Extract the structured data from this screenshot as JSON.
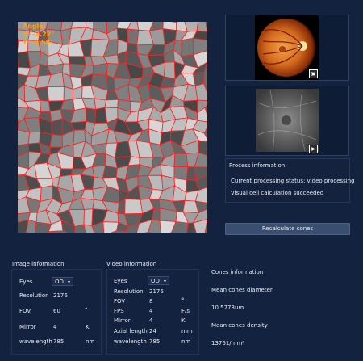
{
  "main_image": {
    "overlay": {
      "angle_label": "Angle:",
      "x_label": "X: -2.22°",
      "y_label": "Y: -0.58°"
    }
  },
  "thumbnails": {
    "fundus_icon": "expand-icon",
    "ir_icon": "play-icon"
  },
  "process_info": {
    "title": "Process information",
    "status": "Current processing status: video processing",
    "result": "Visual cell calculation succeeded"
  },
  "recalculate_button": "Recalculate cones",
  "image_info": {
    "title": "Image information",
    "eyes_label": "Eyes",
    "eyes_value": "OD",
    "resolution_label": "Resolution",
    "resolution_value": "2176",
    "fov_label": "FOV",
    "fov_value": "60",
    "fov_unit": "°",
    "mirror_label": "Mirror",
    "mirror_value": "4",
    "mirror_unit": "K",
    "wavelength_label": "wavelength",
    "wavelength_value": "785",
    "wavelength_unit": "nm"
  },
  "video_info": {
    "title": "Video information",
    "eyes_label": "Eyes",
    "eyes_value": "OD",
    "resolution_label": "Resolution",
    "resolution_value": "2176",
    "fov_label": "FOV",
    "fov_value": "8",
    "fov_unit": "°",
    "fps_label": "FPS",
    "fps_value": "4",
    "fps_unit": "F/s",
    "mirror_label": "Mirror",
    "mirror_value": "4",
    "mirror_unit": "K",
    "axial_label": "Axial length",
    "axial_value": "24",
    "axial_unit": "mm",
    "wavelength_label": "wavelength",
    "wavelength_value": "785",
    "wavelength_unit": "nm"
  },
  "cones_info": {
    "title": "Cones information",
    "diameter_label": "Mean cones diameter",
    "diameter_value": "10.5773um",
    "density_label": "Mean cones density",
    "density_value": "13761/mm²"
  },
  "colors": {
    "background": "#13223f",
    "cell_outline": "#ff2020",
    "overlay_text": "#f7a614",
    "button": "#3a4f70"
  }
}
